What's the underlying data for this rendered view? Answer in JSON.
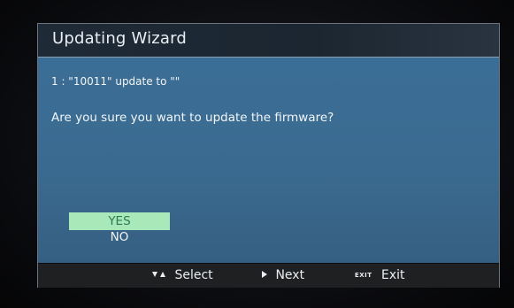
{
  "dialog": {
    "title": "Updating Wizard",
    "line1": "1 : \"10011\"  update to  \"\"",
    "question": "Are you sure you want to update the firmware?",
    "options": [
      {
        "label": "YES",
        "selected": true
      },
      {
        "label": "NO",
        "selected": false
      }
    ]
  },
  "footer": {
    "select_label": "Select",
    "next_label": "Next",
    "exit_key": "EXIT",
    "exit_label": "Exit"
  },
  "icons": {
    "select": "up-down-arrows-icon",
    "next": "play-right-icon"
  },
  "colors": {
    "dialog_body": "#3b6e96",
    "title_bar": "#1e2a36",
    "footer_bar": "#1f2022",
    "selected_option_bg": "#a9e8b8",
    "selected_option_text": "#2d7b54"
  }
}
